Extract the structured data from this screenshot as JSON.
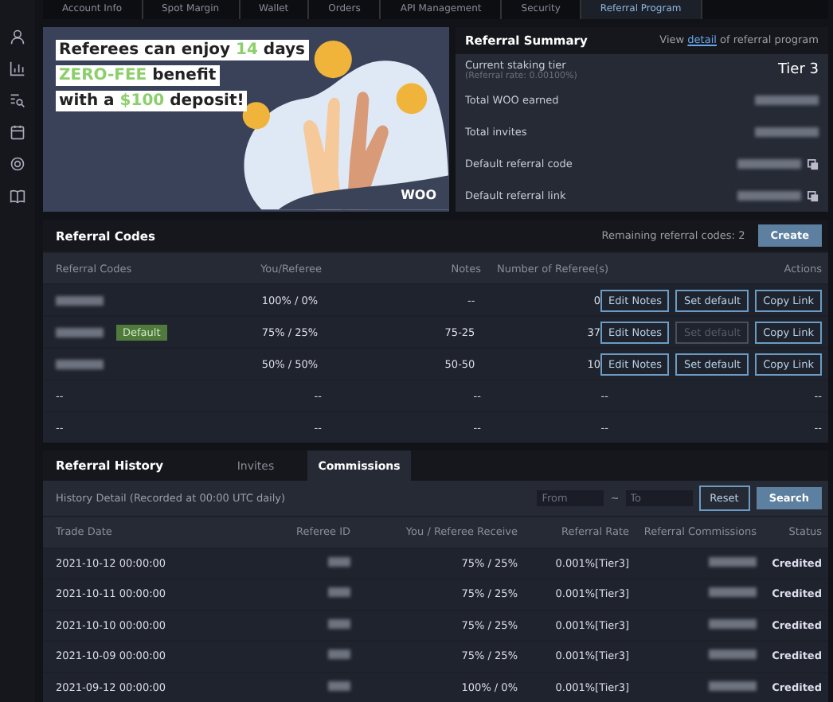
{
  "top_tabs": [
    {
      "label": "Account Info",
      "selected": false
    },
    {
      "label": "Spot Margin",
      "selected": false
    },
    {
      "label": "Wallet",
      "selected": false
    },
    {
      "label": "Orders",
      "selected": false
    },
    {
      "label": "API Management",
      "selected": false
    },
    {
      "label": "Security",
      "selected": false
    },
    {
      "label": "Referral Program",
      "selected": true
    }
  ],
  "banner": {
    "lines": [
      [
        {
          "text": "Referees can enjoy ",
          "highlight": false
        },
        {
          "text": "14",
          "highlight": true
        },
        {
          "text": " days",
          "highlight": false
        }
      ],
      [
        {
          "text": "ZERO-FEE",
          "highlight": true
        },
        {
          "text": " benefit",
          "highlight": false
        }
      ],
      [
        {
          "text": "with a ",
          "highlight": false
        },
        {
          "text": "$100",
          "highlight": true
        },
        {
          "text": " deposit!",
          "highlight": false
        }
      ]
    ],
    "logo": "WOO"
  },
  "summary": {
    "title": "Referral Summary",
    "link_prefix": "View ",
    "link": "detail",
    "link_suffix": " of referral program",
    "rows": [
      {
        "label": "Current staking tier",
        "sublabel": "(Referral rate: 0.00100%)",
        "value": "Tier 3",
        "copy": false
      },
      {
        "label": "Total WOO earned",
        "copy": false
      },
      {
        "label": "Total invites",
        "copy": false
      },
      {
        "label": "Default referral code",
        "copy": true
      },
      {
        "label": "Default referral link",
        "copy": true
      }
    ]
  },
  "referral_codes": {
    "title": "Referral Codes",
    "remaining": "Remaining referral codes: 2",
    "create": "Create",
    "columns": [
      "Referral Codes",
      "You/Referee",
      "Notes",
      "Number of Referee(s)",
      "Actions"
    ],
    "rows": [
      {
        "badge": "",
        "split": "100% / 0%",
        "notes": "--",
        "count": "0",
        "actions": [
          {
            "label": "Edit Notes",
            "disabled": false
          },
          {
            "label": "Set default",
            "disabled": false
          },
          {
            "label": "Copy Link",
            "disabled": false
          }
        ]
      },
      {
        "badge": "Default",
        "split": "75% / 25%",
        "notes": "75-25",
        "count": "37",
        "actions": [
          {
            "label": "Edit Notes",
            "disabled": false
          },
          {
            "label": "Set default",
            "disabled": true
          },
          {
            "label": "Copy Link",
            "disabled": false
          }
        ]
      },
      {
        "badge": "",
        "split": "50% / 50%",
        "notes": "50-50",
        "count": "10",
        "actions": [
          {
            "label": "Edit Notes",
            "disabled": false
          },
          {
            "label": "Set default",
            "disabled": false
          },
          {
            "label": "Copy Link",
            "disabled": false
          }
        ]
      }
    ],
    "empty_rows": [
      [
        "--",
        "--",
        "--",
        "--",
        "--"
      ],
      [
        "--",
        "--",
        "--",
        "--",
        "--"
      ]
    ]
  },
  "history": {
    "tabs": [
      {
        "label": "Referral History",
        "selected": false,
        "kind": "title"
      },
      {
        "label": "Invites",
        "selected": false,
        "kind": "tab"
      },
      {
        "label": "Commissions",
        "selected": true,
        "kind": "tab"
      }
    ],
    "detail": "History Detail (Recorded at 00:00 UTC daily)",
    "from_placeholder": "From",
    "separator": "~",
    "to_placeholder": "To",
    "reset": "Reset",
    "search": "Search",
    "columns": [
      "Trade Date",
      "Referee ID",
      "You / Referee Receive",
      "Referral Rate",
      "Referral Commissions",
      "Status"
    ],
    "rows": [
      {
        "date": "2021-10-12 00:00:00",
        "split": "75% / 25%",
        "rate": "0.001%[Tier3]",
        "status": "Credited"
      },
      {
        "date": "2021-10-11 00:00:00",
        "split": "75% / 25%",
        "rate": "0.001%[Tier3]",
        "status": "Credited"
      },
      {
        "date": "2021-10-10 00:00:00",
        "split": "75% / 25%",
        "rate": "0.001%[Tier3]",
        "status": "Credited"
      },
      {
        "date": "2021-10-09 00:00:00",
        "split": "75% / 25%",
        "rate": "0.001%[Tier3]",
        "status": "Credited"
      },
      {
        "date": "2021-09-12 00:00:00",
        "split": "100% / 0%",
        "rate": "0.001%[Tier3]",
        "status": "Credited"
      }
    ]
  }
}
